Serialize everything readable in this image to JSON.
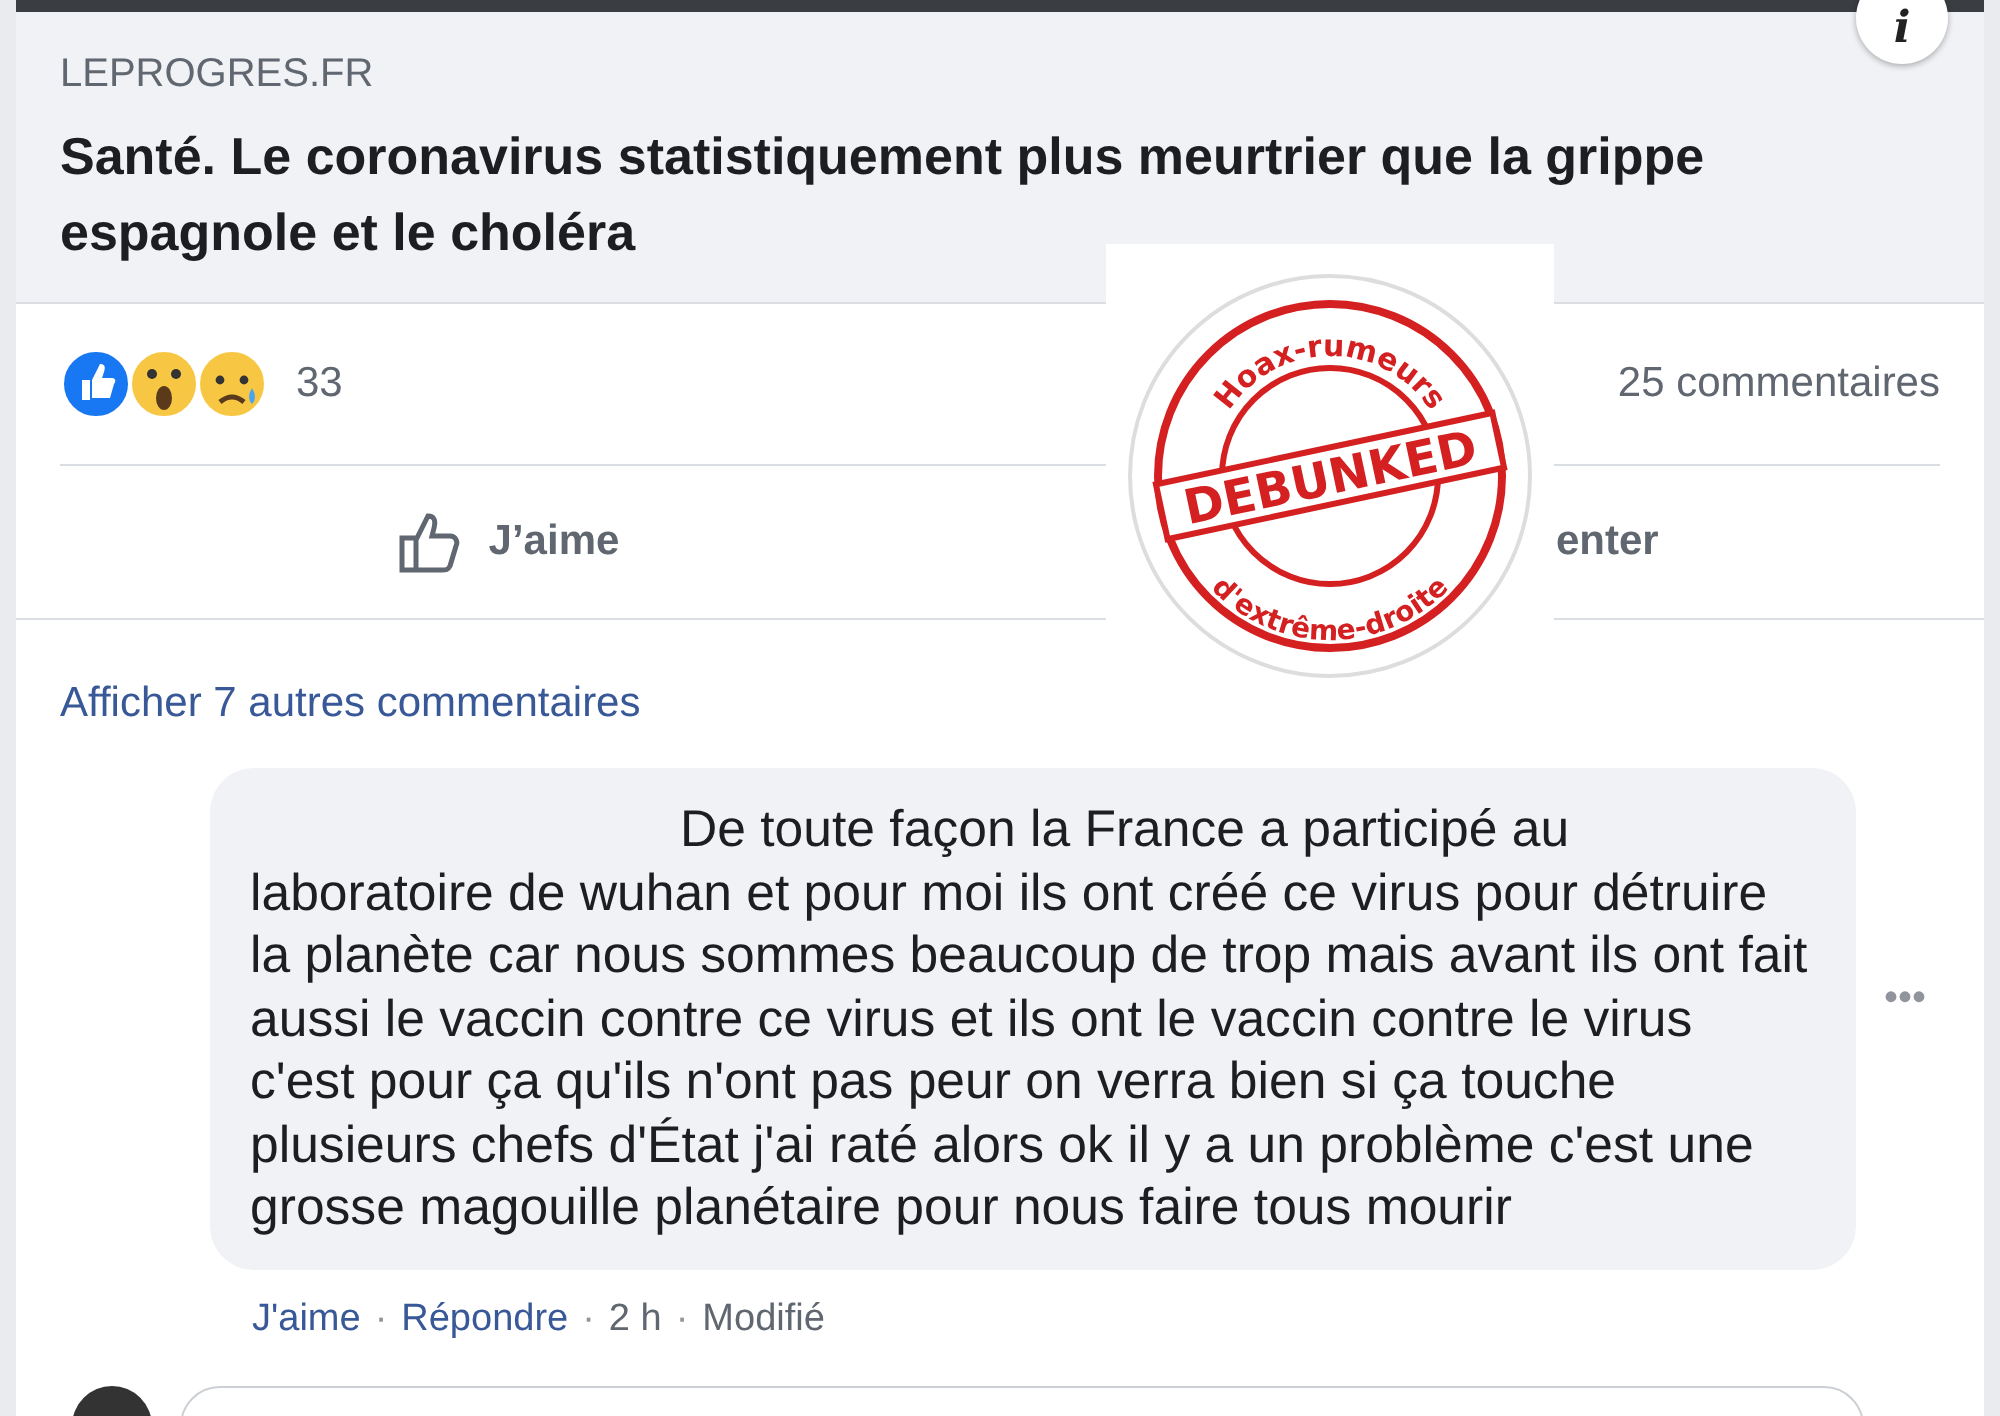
{
  "info_icon": "i",
  "link_preview": {
    "domain": "LEPROGRES.FR",
    "title": "Santé. Le coronavirus statistiquement plus meurtrier que la grippe espagnole et le choléra"
  },
  "reactions": {
    "count": "33",
    "comments": "25 commentaires"
  },
  "actions": [
    {
      "kind": "like",
      "label": "J’aime"
    },
    {
      "kind": "comment",
      "label": "enter"
    }
  ],
  "more_comments": "Afficher 7 autres commentaires",
  "comment": {
    "text": "De toute façon la France a participé au laboratoire de wuhan et pour moi ils ont créé ce virus pour détruire la planète car nous sommes beaucoup de trop mais avant ils ont fait aussi le vaccin contre ce virus et ils ont le vaccin contre le virus c'est pour ça qu'ils n'ont pas peur on verra bien si ça touche plusieurs chefs d'État j'ai raté alors ok il y a un problème c'est une grosse magouille planétaire pour nous faire tous mourir",
    "like": "J'aime",
    "reply": "Répondre",
    "time": "2 h",
    "edited": "Modifié",
    "separators": [
      "·",
      "·",
      "·"
    ],
    "more": "•••"
  },
  "stamp": {
    "top": "Hoax-rumeurs",
    "main": "DEBUNKED",
    "bottom": "d'extrême-droite"
  }
}
